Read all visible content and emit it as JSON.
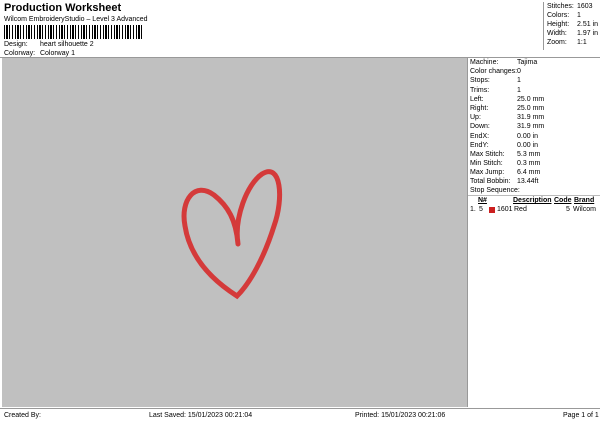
{
  "header": {
    "title": "Production Worksheet",
    "subtitle": "Wilcom EmbroideryStudio – Level 3 Advanced",
    "design_label": "Design:",
    "design_value": "heart silhouette 2",
    "colorway_label": "Colorway:",
    "colorway_value": "Colorway 1"
  },
  "stats": [
    {
      "label": "Stitches:",
      "value": "1603"
    },
    {
      "label": "Colors:",
      "value": "1"
    },
    {
      "label": "Height:",
      "value": "2.51 in"
    },
    {
      "label": "Width:",
      "value": "1.97 in"
    },
    {
      "label": "Zoom:",
      "value": "1:1"
    }
  ],
  "machine_info": [
    {
      "label": "Machine:",
      "value": "Tajima"
    },
    {
      "label": "Color changes:",
      "value": "0"
    },
    {
      "label": "Stops:",
      "value": "1"
    },
    {
      "label": "Trims:",
      "value": "1"
    },
    {
      "label": "Left:",
      "value": "25.0 mm"
    },
    {
      "label": "Right:",
      "value": "25.0 mm"
    },
    {
      "label": "Up:",
      "value": "31.9 mm"
    },
    {
      "label": "Down:",
      "value": "31.9 mm"
    },
    {
      "label": "EndX:",
      "value": "0.00 in"
    },
    {
      "label": "EndY:",
      "value": "0.00 in"
    },
    {
      "label": "Max Stitch:",
      "value": "5.3 mm"
    },
    {
      "label": "Min Stitch:",
      "value": "0.3 mm"
    },
    {
      "label": "Max Jump:",
      "value": "6.4 mm"
    },
    {
      "label": "Total Bobbin:",
      "value": "13.44ft"
    }
  ],
  "stop_sequence": {
    "title": "Stop Sequence:",
    "columns": {
      "num": "N#",
      "description": "Description",
      "code": "Code",
      "brand": "Brand"
    },
    "rows": [
      {
        "index": "1.",
        "num": "5",
        "color": "#cc1f1f",
        "code_num": "1601",
        "description": "Red",
        "code": "5",
        "brand": "Wilcom"
      }
    ]
  },
  "design_color": "#d43a3a",
  "footer": {
    "created_by": "Created By:",
    "last_saved": "Last Saved: 15/01/2023 00:21:04",
    "printed": "Printed: 15/01/2023 00:21:06",
    "page": "Page 1 of 1"
  }
}
